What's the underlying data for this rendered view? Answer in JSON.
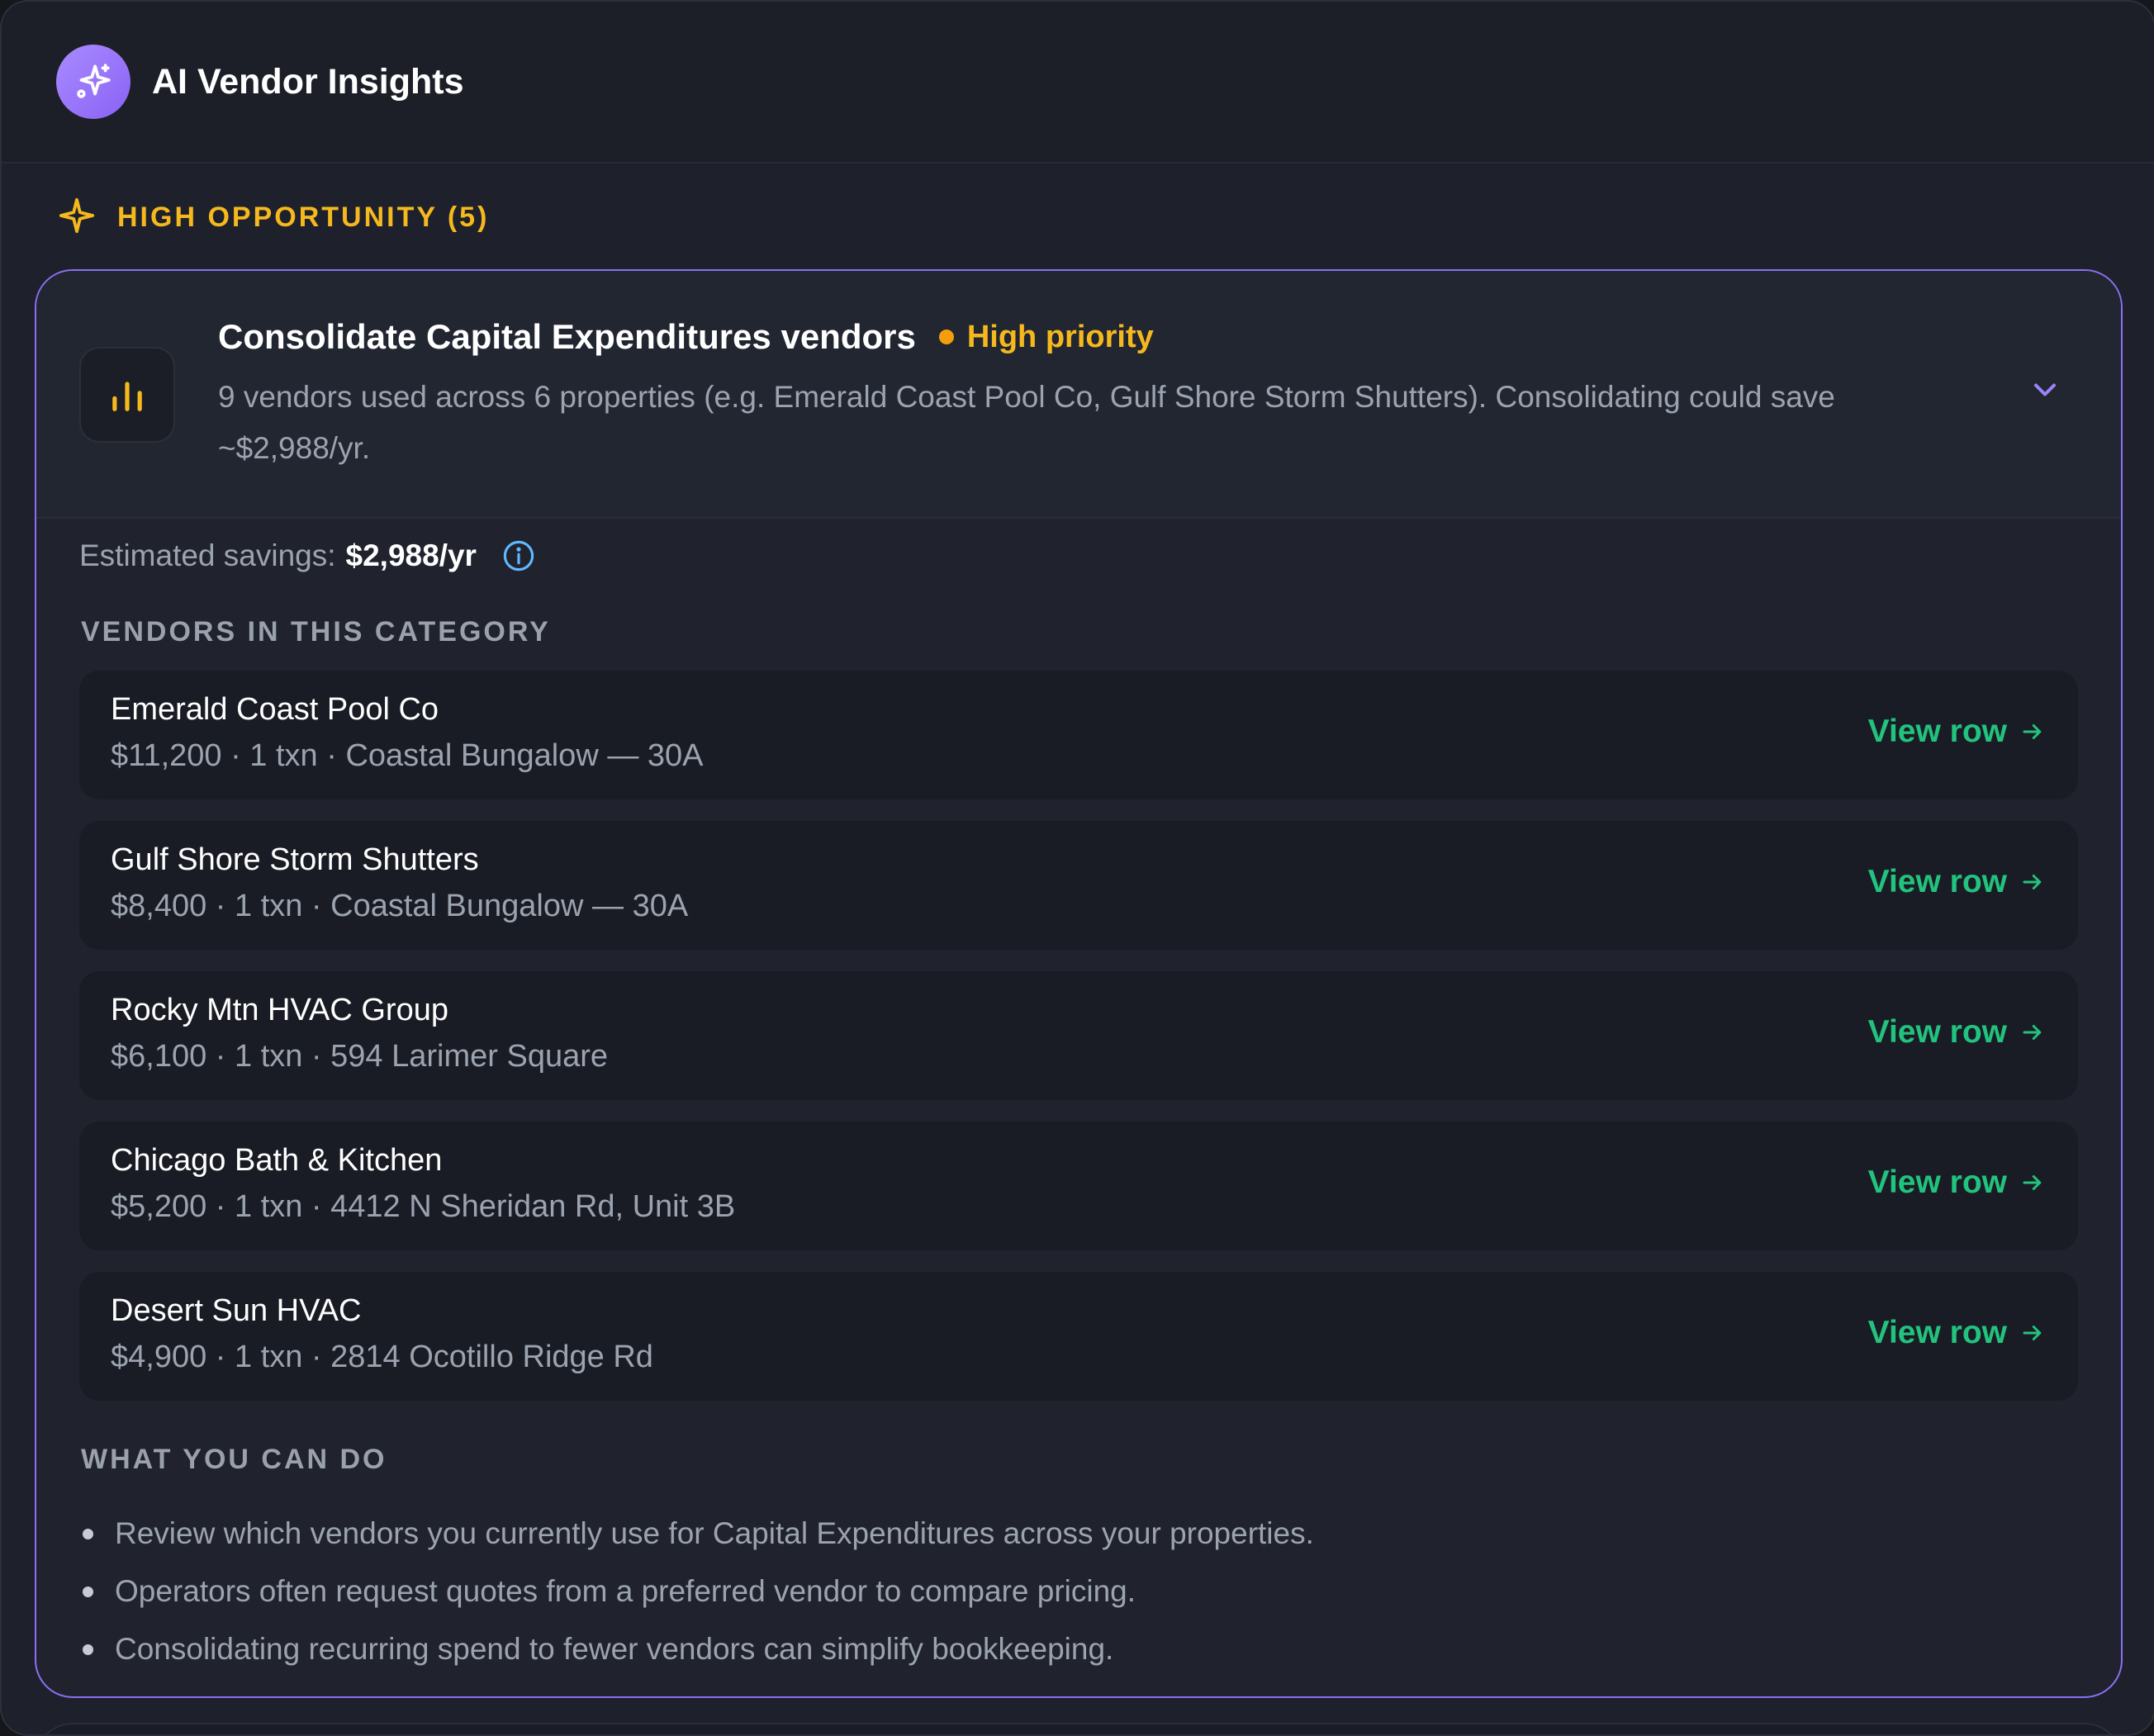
{
  "header": {
    "title": "AI Vendor Insights",
    "icon": "sparkles-icon"
  },
  "section": {
    "label": "HIGH OPPORTUNITY (5)",
    "icon": "sparkle-icon",
    "color": "#f5b81e"
  },
  "card": {
    "icon": "bar-chart-icon",
    "title": "Consolidate Capital Expenditures vendors",
    "priority": "High priority",
    "description": "9 vendors used across 6 properties (e.g. Emerald Coast Pool Co, Gulf Shore Storm Shutters). Consolidating could save ~$2,988/yr.",
    "savings_label": "Estimated savings:",
    "savings_value": "$2,988/yr",
    "vendors_heading": "VENDORS IN THIS CATEGORY",
    "vendors": [
      {
        "name": "Emerald Coast Pool Co",
        "meta": "$11,200 · 1 txn · Coastal Bungalow — 30A",
        "action": "View row"
      },
      {
        "name": "Gulf Shore Storm Shutters",
        "meta": "$8,400 · 1 txn · Coastal Bungalow — 30A",
        "action": "View row"
      },
      {
        "name": "Rocky Mtn HVAC Group",
        "meta": "$6,100 · 1 txn · 594 Larimer Square",
        "action": "View row"
      },
      {
        "name": "Chicago Bath & Kitchen",
        "meta": "$5,200 · 1 txn · 4412 N Sheridan Rd, Unit 3B",
        "action": "View row"
      },
      {
        "name": "Desert Sun HVAC",
        "meta": "$4,900 · 1 txn · 2814 Ocotillo Ridge Rd",
        "action": "View row"
      }
    ],
    "actions_heading": "WHAT YOU CAN DO",
    "actions": [
      "Review which vendors you currently use for Capital Expenditures across your properties.",
      "Operators often request quotes from a preferred vendor to compare pricing.",
      "Consolidating recurring spend to fewer vendors can simplify bookkeeping."
    ]
  },
  "colors": {
    "accent": "#8b6ff3",
    "success": "#22c37e",
    "warning": "#f59e0b"
  }
}
